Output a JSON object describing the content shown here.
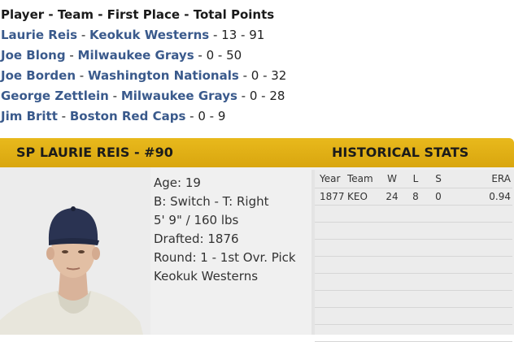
{
  "voting": {
    "header": "Player - Team - First Place - Total Points",
    "rows": [
      {
        "player": "Laurie Reis",
        "team": "Keokuk Westerns",
        "first": "13",
        "points": "91"
      },
      {
        "player": "Joe Blong",
        "team": "Milwaukee Grays",
        "first": "0",
        "points": "50"
      },
      {
        "player": "Joe Borden",
        "team": "Washington Nationals",
        "first": "0",
        "points": "32"
      },
      {
        "player": "George Zettlein",
        "team": "Milwaukee Grays",
        "first": "0",
        "points": "28"
      },
      {
        "player": "Jim Britt",
        "team": "Boston Red Caps",
        "first": "0",
        "points": "9"
      }
    ]
  },
  "player_card": {
    "title": "SP LAURIE REIS - #90",
    "stats_title": "HISTORICAL STATS",
    "age": "Age: 19",
    "bats_throws": "B: Switch - T: Right",
    "height_weight": "5' 9\" / 160 lbs",
    "drafted": "Drafted: 1876",
    "round": "Round: 1 - 1st Ovr. Pick",
    "team": "Keokuk Westerns"
  },
  "stats": {
    "columns": [
      "Year",
      "Team",
      "W",
      "L",
      "S",
      "ERA"
    ],
    "rows": [
      {
        "year": "1877",
        "team": "KEO",
        "w": "24",
        "l": "8",
        "s": "0",
        "era": "0.94"
      }
    ]
  },
  "colors": {
    "banner": "#e3b418",
    "link": "#3a5a8c"
  }
}
